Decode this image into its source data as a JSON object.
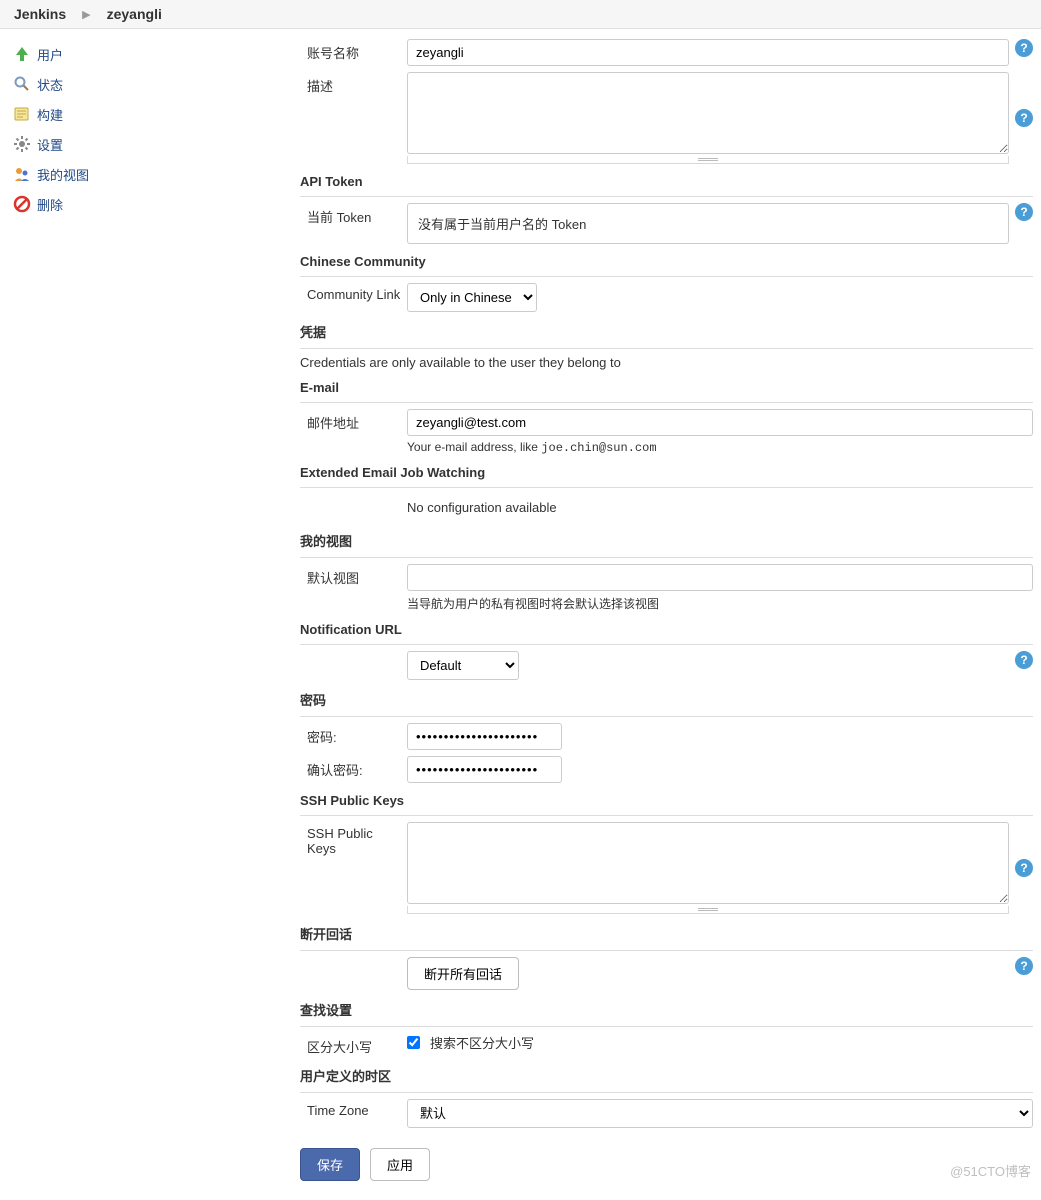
{
  "breadcrumb": {
    "root": "Jenkins",
    "user": "zeyangli"
  },
  "sidebar": {
    "items": [
      {
        "label": "用户"
      },
      {
        "label": "状态"
      },
      {
        "label": "构建"
      },
      {
        "label": "设置"
      },
      {
        "label": "我的视图"
      },
      {
        "label": "删除"
      }
    ]
  },
  "form": {
    "account_name_label": "账号名称",
    "account_name_value": "zeyangli",
    "description_label": "描述",
    "description_value": "",
    "api_token_title": "API Token",
    "current_token_label": "当前 Token",
    "current_token_text": "没有属于当前用户名的 Token",
    "chinese_comm_title": "Chinese Community",
    "community_link_label": "Community Link",
    "community_link_value": "Only in Chinese",
    "credentials_title": "凭据",
    "credentials_text": "Credentials are only available to the user they belong to",
    "email_title": "E-mail",
    "email_label": "邮件地址",
    "email_value": "zeyangli@test.com",
    "email_hint_prefix": "Your e-mail address, like ",
    "email_hint_example": "joe.chin@sun.com",
    "ext_email_title": "Extended Email Job Watching",
    "ext_email_text": "No configuration available",
    "my_views_title": "我的视图",
    "default_view_label": "默认视图",
    "default_view_value": "",
    "default_view_hint": "当导航为用户的私有视图时将会默认选择该视图",
    "notif_url_title": "Notification URL",
    "notif_url_value": "Default",
    "password_title": "密码",
    "password_label": "密码:",
    "password_value": "••••••••••••••••••••••",
    "confirm_password_label": "确认密码:",
    "confirm_password_value": "••••••••••••••••••••••",
    "ssh_title": "SSH Public Keys",
    "ssh_label": "SSH Public Keys",
    "ssh_value": "",
    "disconnect_title": "断开回话",
    "disconnect_btn": "断开所有回话",
    "search_title": "查找设置",
    "case_label": "区分大小写",
    "case_checkbox_label": "搜索不区分大小写",
    "tz_title": "用户定义的时区",
    "tz_label": "Time Zone",
    "tz_value": "默认",
    "save_btn": "保存",
    "apply_btn": "应用"
  },
  "watermark": "@51CTO博客"
}
